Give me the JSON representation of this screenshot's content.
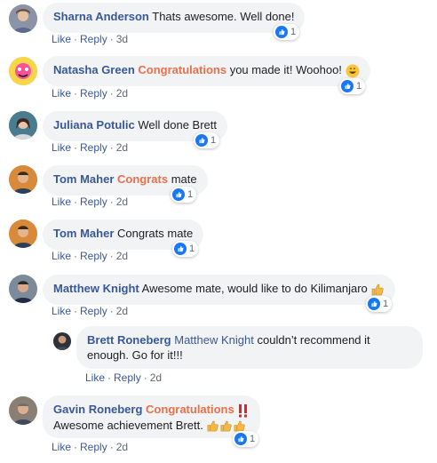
{
  "comments": [
    {
      "name": "Sharna Anderson",
      "text": "Thats awesome. Well done!",
      "likes": "1",
      "like_label": "Like",
      "reply_label": "Reply",
      "time": "3d"
    },
    {
      "name": "Natasha Green",
      "tag": "Congratulations",
      "text": "you made it! Woohoo!",
      "emoji_icon": "grinning-face-emoji",
      "likes": "1",
      "like_label": "Like",
      "reply_label": "Reply",
      "time": "2d"
    },
    {
      "name": "Juliana Potulic",
      "text": "Well done Brett",
      "likes": "1",
      "like_label": "Like",
      "reply_label": "Reply",
      "time": "2d"
    },
    {
      "name": "Tom Maher",
      "tag": "Congrats",
      "text": "mate",
      "likes": "1",
      "like_label": "Like",
      "reply_label": "Reply",
      "time": "2d"
    },
    {
      "name": "Tom Maher",
      "text": "Congrats mate",
      "likes": "1",
      "like_label": "Like",
      "reply_label": "Reply",
      "time": "2d"
    },
    {
      "name": "Matthew Knight",
      "text": "Awesome mate, would like to do Kilimanjaro",
      "emoji_icon": "thumbs-up-emoji",
      "likes": "1",
      "like_label": "Like",
      "reply_label": "Reply",
      "time": "2d"
    },
    {
      "name": "Gavin Roneberg",
      "tag": "Congratulations",
      "emoji_icon": "double-exclamation-emoji",
      "text": "Awesome achievement Brett.",
      "emoji_icon_2": "thumbs-up-emoji",
      "likes": "1",
      "like_label": "Like",
      "reply_label": "Reply",
      "time": "2d"
    }
  ],
  "reply": {
    "name": "Brett Roneberg",
    "mention": "Matthew Knight",
    "text_line1": "couldn’t recommend it",
    "text_line2": "enough. Go for it!!!",
    "like_label": "Like",
    "reply_label": "Reply",
    "time": "2d"
  },
  "colors": {
    "name": "#385898",
    "tag": "#e9704a",
    "bubble": "#f2f3f5",
    "like": "#1877f2"
  }
}
